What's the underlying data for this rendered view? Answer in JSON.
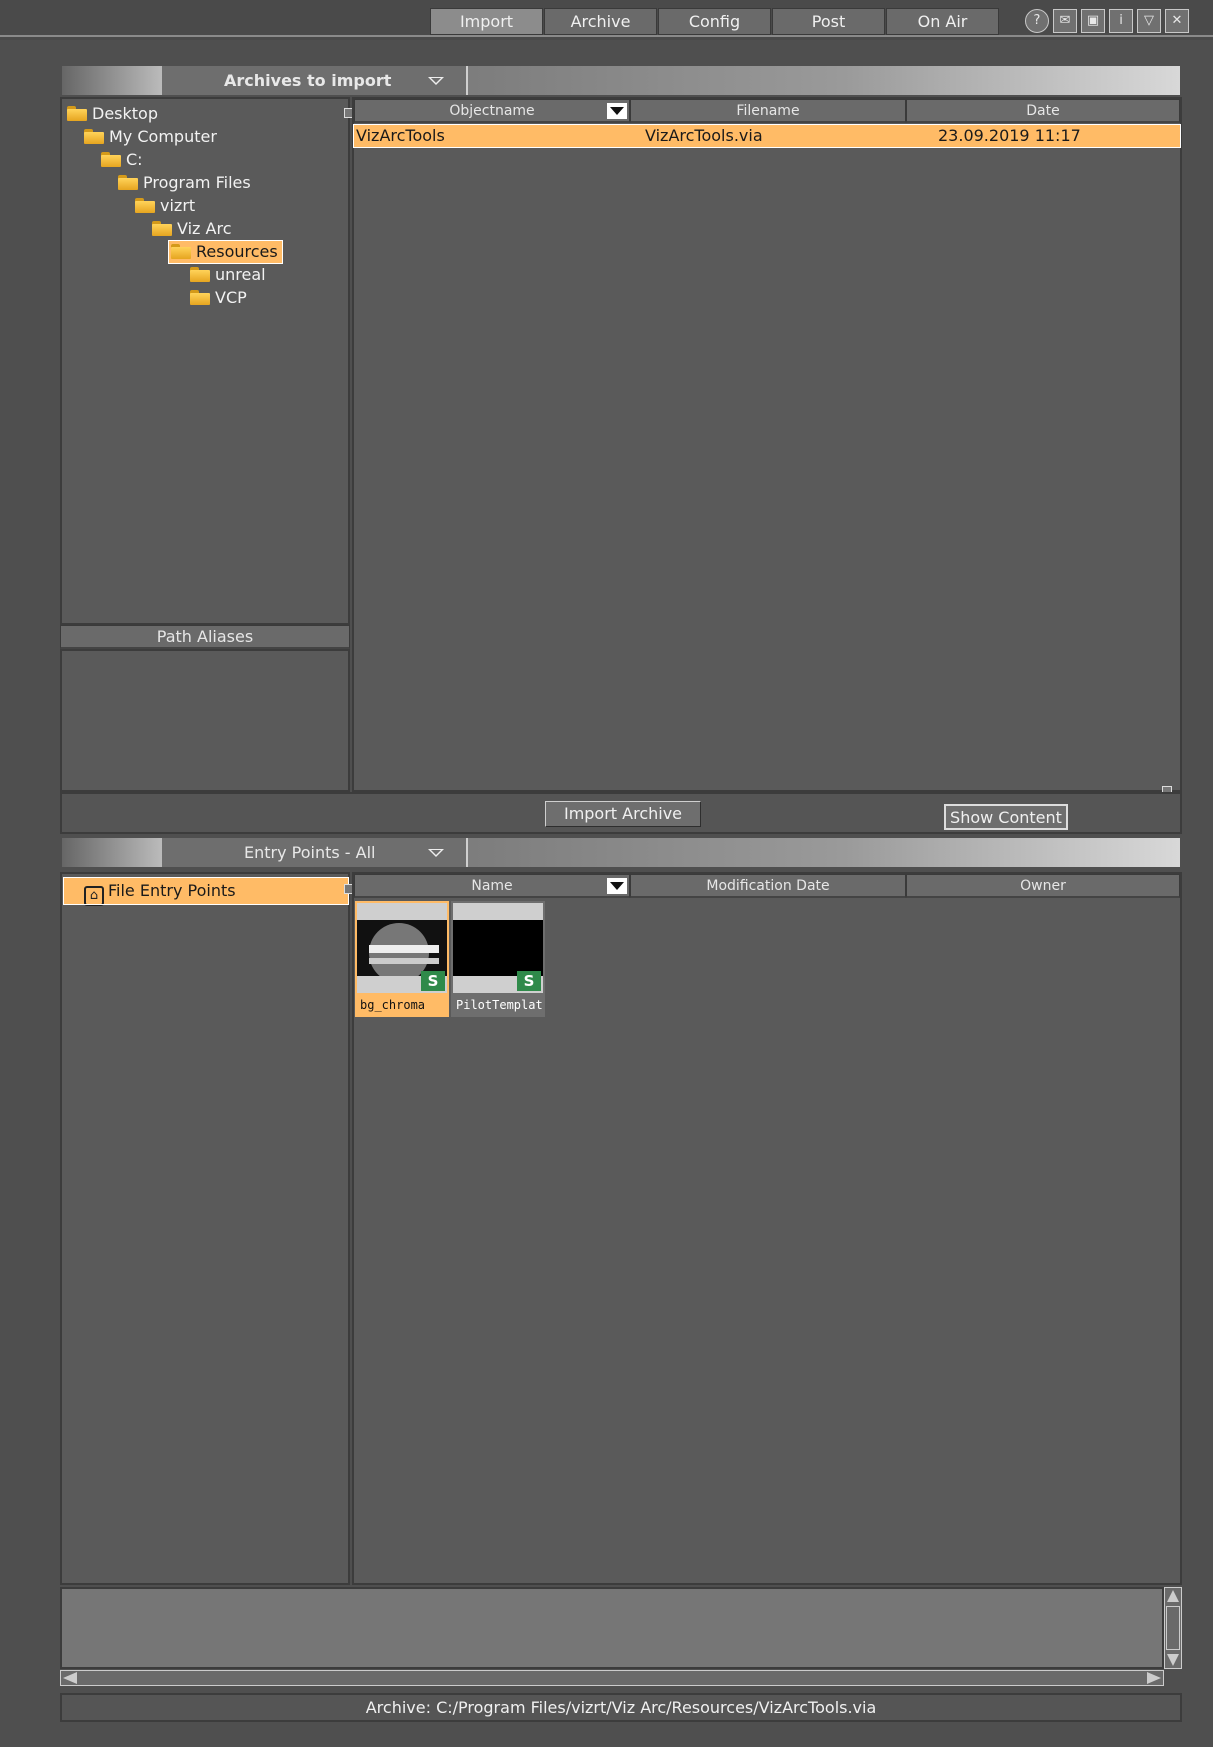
{
  "topbar": {
    "tabs": [
      "Import",
      "Archive",
      "Config",
      "Post",
      "On Air"
    ],
    "active_tab": "Import",
    "icons": [
      "help-icon",
      "mail-icon",
      "screen-icon",
      "info-icon",
      "minimize-icon",
      "close-icon"
    ]
  },
  "archives": {
    "dropdown_label": "Archives to import",
    "tree": [
      {
        "label": "Desktop",
        "level": 0
      },
      {
        "label": "My Computer",
        "level": 1
      },
      {
        "label": "C:",
        "level": 2
      },
      {
        "label": "Program Files",
        "level": 3
      },
      {
        "label": "vizrt",
        "level": 4
      },
      {
        "label": "Viz Arc",
        "level": 5
      },
      {
        "label": "Resources",
        "level": 6,
        "selected": true
      },
      {
        "label": "unreal",
        "level": 7
      },
      {
        "label": "VCP",
        "level": 7
      }
    ],
    "path_aliases_label": "Path Aliases",
    "columns": {
      "objectname": "Objectname",
      "filename": "Filename",
      "date": "Date"
    },
    "rows": [
      {
        "objectname": "VizArcTools",
        "filename": "VizArcTools.via",
        "date": "23.09.2019 11:17"
      }
    ],
    "import_button": "Import Archive",
    "show_content_button": "Show Content"
  },
  "entry_points": {
    "dropdown_label": "Entry Points - All",
    "tree_item": "File Entry Points",
    "columns": {
      "name": "Name",
      "modification_date": "Modification Date",
      "owner": "Owner"
    },
    "items": [
      {
        "label": "bg_chroma",
        "badge": "S",
        "selected": true
      },
      {
        "label": "PilotTemplat",
        "badge": "S",
        "selected": false
      }
    ]
  },
  "status": {
    "archive_path": "Archive: C:/Program Files/vizrt/Viz Arc/Resources/VizArcTools.via"
  },
  "colors": {
    "selection": "#ffbb66",
    "panel": "#5a5a5a",
    "background": "#4f4f4f",
    "badge": "#2f8a4a"
  }
}
